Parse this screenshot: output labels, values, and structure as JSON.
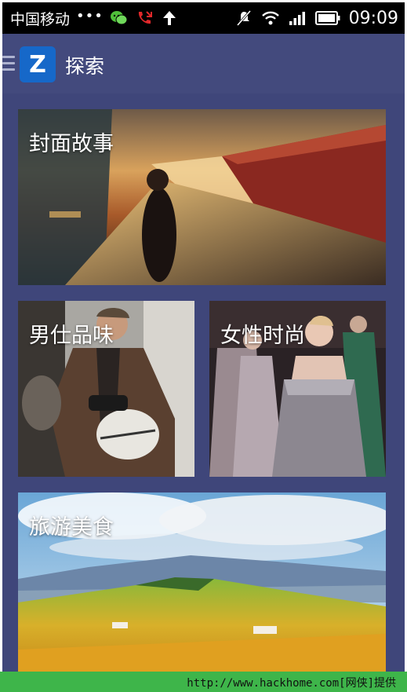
{
  "status_bar": {
    "carrier": "中国移动",
    "dots": "•••",
    "time": "09:09",
    "icons": [
      "wechat-icon",
      "missed-call-icon",
      "upload-arrow-icon",
      "mute-icon",
      "wifi-icon",
      "signal-icon",
      "battery-icon"
    ]
  },
  "app_bar": {
    "logo_letter": "Z",
    "title": "探索"
  },
  "cards": [
    {
      "label": "封面故事"
    },
    {
      "label": "男仕品味"
    },
    {
      "label": "女性时尚"
    },
    {
      "label": "旅游美食"
    }
  ],
  "footer": {
    "text": "http://www.hackhome.com[网侠]提供"
  },
  "colors": {
    "background": "#3f467a",
    "app_bar": "#434a7d",
    "logo": "#1668c9",
    "footer": "#3eb54a"
  }
}
